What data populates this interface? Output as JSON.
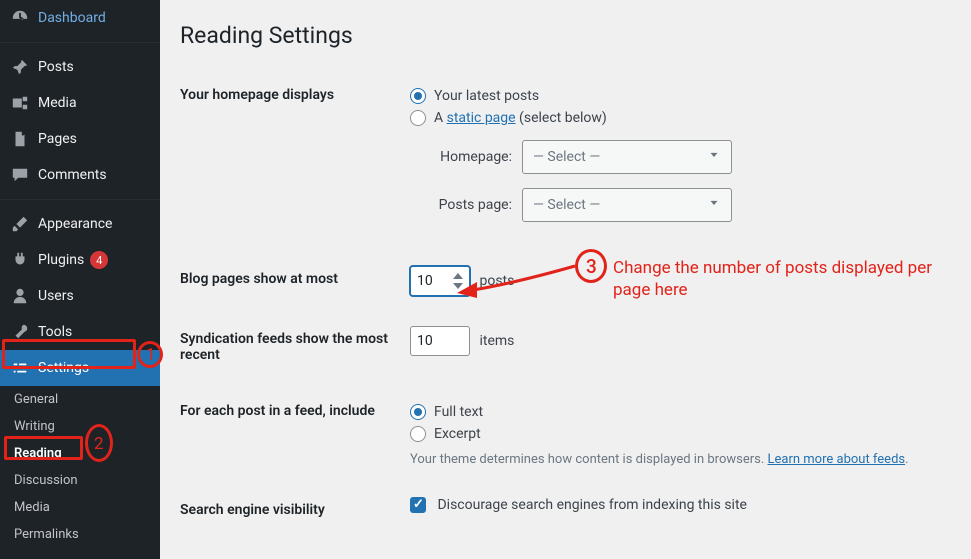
{
  "sidebar": {
    "dashboard": "Dashboard",
    "posts": "Posts",
    "media": "Media",
    "pages": "Pages",
    "comments": "Comments",
    "appearance": "Appearance",
    "plugins": "Plugins",
    "plugins_badge": "4",
    "users": "Users",
    "tools": "Tools",
    "settings": "Settings",
    "sub": {
      "general": "General",
      "writing": "Writing",
      "reading": "Reading",
      "discussion": "Discussion",
      "media": "Media",
      "permalinks": "Permalinks"
    }
  },
  "page": {
    "title": "Reading Settings",
    "homepage_label": "Your homepage displays",
    "opt_latest": "Your latest posts",
    "opt_static_prefix": "A ",
    "opt_static_link": "static page",
    "opt_static_suffix": " (select below)",
    "homepage_field_label": "Homepage:",
    "posts_page_field_label": "Posts page:",
    "select_placeholder": "— Select —",
    "blog_pages_label": "Blog pages show at most",
    "blog_pages_value": "10",
    "blog_pages_unit": "posts",
    "syndication_label": "Syndication feeds show the most recent",
    "syndication_value": "10",
    "syndication_unit": "items",
    "feed_label": "For each post in a feed, include",
    "opt_full": "Full text",
    "opt_excerpt": "Excerpt",
    "feed_desc_prefix": "Your theme determines how content is displayed in browsers. ",
    "feed_desc_link": "Learn more about feeds",
    "feed_desc_suffix": ".",
    "search_label": "Search engine visibility",
    "search_checkbox": "Discourage search engines from indexing this site"
  },
  "annotations": {
    "n1": "1",
    "n2": "2",
    "n3": "3",
    "tip": "Change the number of posts displayed per page here"
  }
}
